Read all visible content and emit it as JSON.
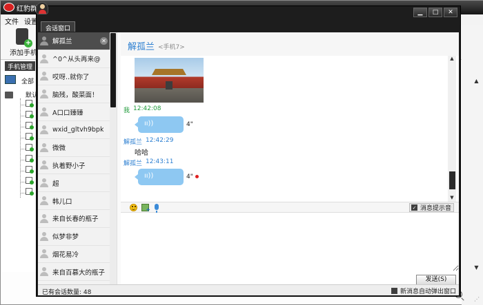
{
  "main_window": {
    "title": "红豹群控",
    "menu": [
      "文件",
      "设置"
    ],
    "toolbar": {
      "add_phone_label": "添加手机"
    },
    "tab_label": "手机管理",
    "tree": {
      "root_label": "全部",
      "group_label": "默认"
    }
  },
  "chat_window": {
    "controls": {
      "minimize": "▁",
      "maximize": "□",
      "close": "✕"
    },
    "tab_label": "会话窗口",
    "contacts": [
      {
        "name": "解孤兰",
        "active": true
      },
      {
        "name": "^0^从头再来@"
      },
      {
        "name": "哎呀..就你了"
      },
      {
        "name": "脑残，酸菜面！"
      },
      {
        "name": "A口口臻臻"
      },
      {
        "name": "wxid_gltvh9bpk"
      },
      {
        "name": "微微"
      },
      {
        "name": "执着野小子"
      },
      {
        "name": "超"
      },
      {
        "name": "韩儿口"
      },
      {
        "name": "来自长春的瓶子"
      },
      {
        "name": "似梦非梦"
      },
      {
        "name": "烟花易冷"
      },
      {
        "name": "来自百慕大的瓶子"
      }
    ],
    "header": {
      "name": "解孤兰",
      "subtitle": "<手机7>"
    },
    "messages": {
      "m1_sender": "我",
      "m1_time": "12:42:08",
      "m1_duration": "4\"",
      "m2_sender": "解孤兰",
      "m2_time": "12:42:29",
      "m2_text": "哈哈",
      "m3_sender": "解孤兰",
      "m3_time": "12:43:11",
      "m3_duration": "4\""
    },
    "toolbar": {
      "notify_label": "消息提示音",
      "notify_checked": true
    },
    "input": {
      "placeholder": ""
    },
    "send_label": "发送(S)",
    "status": {
      "count_text": "已有会话数量: 48",
      "popup_label": "新消息自动弹出窗口"
    }
  },
  "colors": {
    "accent": "#2c7fd1",
    "self_name": "#1f9a3a",
    "voice_bubble": "#8ec8f2",
    "unread": "#e02020"
  }
}
